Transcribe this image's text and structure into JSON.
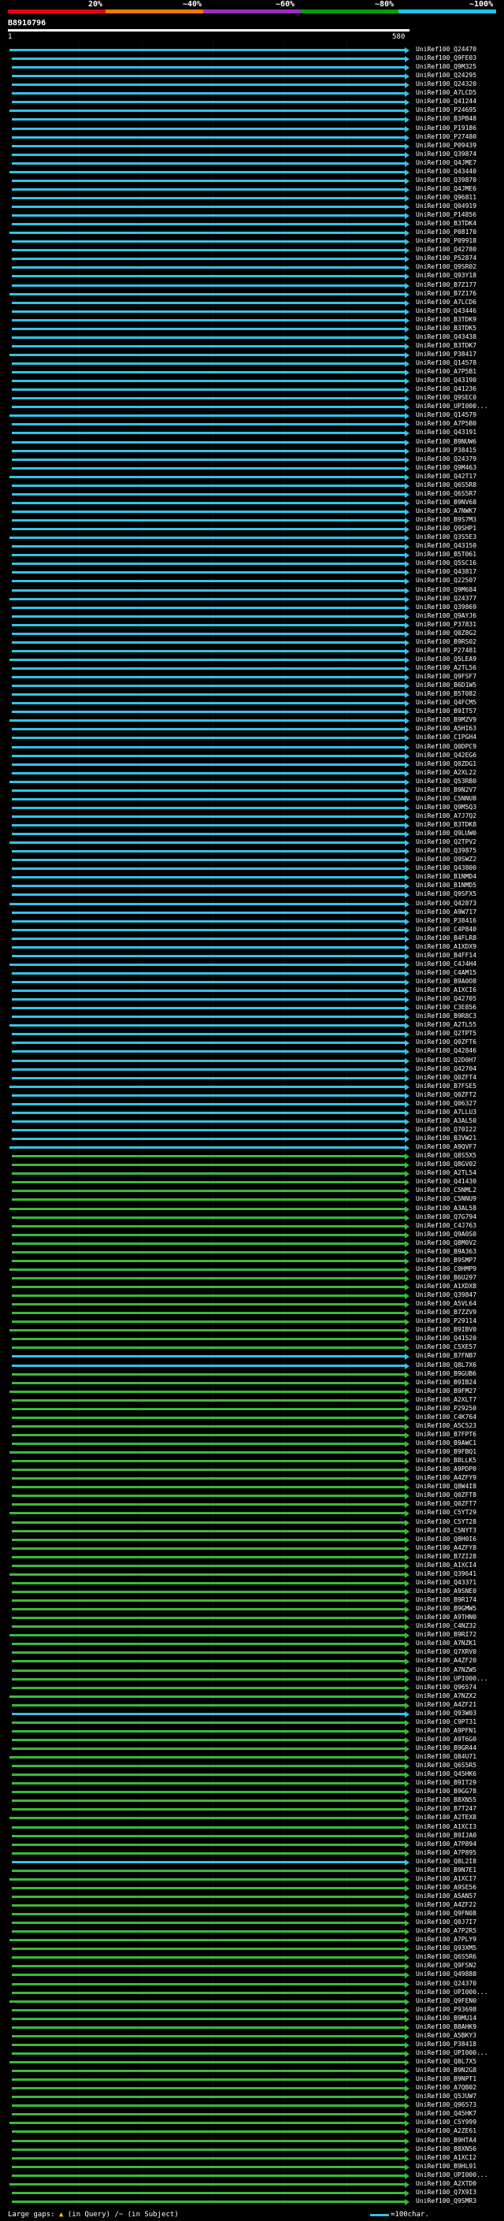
{
  "scale": {
    "labels": [
      "20%",
      "~40%",
      "~60%",
      "~80%",
      "~100%"
    ],
    "colors": [
      "#e8000b",
      "#f07a00",
      "#9b30c0",
      "#00a000",
      "#10c8ff"
    ]
  },
  "query": {
    "id": "B8910796",
    "start": "1",
    "end": "580"
  },
  "colors": {
    "green": "#3cb83c",
    "cyan": "#33c3e5",
    "dark": "#7aa07a",
    "ruler": "#ffffff"
  },
  "hits": [
    {
      "id": "UniRef100_Q24470",
      "color": "cyan"
    },
    {
      "id": "UniRef100_Q9FE03",
      "color": "cyan"
    },
    {
      "id": "UniRef100_Q9M325",
      "color": "cyan"
    },
    {
      "id": "UniRef100_Q24295",
      "color": "cyan"
    },
    {
      "id": "UniRef100_Q24320",
      "color": "cyan"
    },
    {
      "id": "UniRef100_A7LCD5",
      "color": "cyan"
    },
    {
      "id": "UniRef100_Q41244",
      "color": "cyan"
    },
    {
      "id": "UniRef100_P24695",
      "color": "cyan"
    },
    {
      "id": "UniRef100_B3PB48",
      "color": "cyan"
    },
    {
      "id": "UniRef100_P19186",
      "color": "cyan"
    },
    {
      "id": "UniRef100_P27480",
      "color": "cyan"
    },
    {
      "id": "UniRef100_P09439",
      "color": "cyan"
    },
    {
      "id": "UniRef100_Q39874",
      "color": "cyan"
    },
    {
      "id": "UniRef100_Q4JME7",
      "color": "cyan"
    },
    {
      "id": "UniRef100_Q43440",
      "color": "cyan"
    },
    {
      "id": "UniRef100_Q39870",
      "color": "cyan"
    },
    {
      "id": "UniRef100_Q4JME6",
      "color": "cyan"
    },
    {
      "id": "UniRef100_Q96811",
      "color": "cyan"
    },
    {
      "id": "UniRef100_Q04919",
      "color": "cyan"
    },
    {
      "id": "UniRef100_P14856",
      "color": "cyan"
    },
    {
      "id": "UniRef100_B3TDK4",
      "color": "cyan"
    },
    {
      "id": "UniRef100_P08170",
      "color": "cyan"
    },
    {
      "id": "UniRef100_P09918",
      "color": "cyan"
    },
    {
      "id": "UniRef100_Q42780",
      "color": "cyan"
    },
    {
      "id": "UniRef100_P52874",
      "color": "cyan"
    },
    {
      "id": "UniRef100_Q9SR02",
      "color": "cyan"
    },
    {
      "id": "UniRef100_Q93Y18",
      "color": "cyan"
    },
    {
      "id": "UniRef100_B7Z177",
      "color": "cyan"
    },
    {
      "id": "UniRef100_B7Z176",
      "color": "cyan"
    },
    {
      "id": "UniRef100_A7LCD6",
      "color": "cyan"
    },
    {
      "id": "UniRef100_Q43446",
      "color": "cyan"
    },
    {
      "id": "UniRef100_B3TDK9",
      "color": "cyan"
    },
    {
      "id": "UniRef100_B3TDK5",
      "color": "cyan"
    },
    {
      "id": "UniRef100_Q43438",
      "color": "cyan"
    },
    {
      "id": "UniRef100_B3TDK7",
      "color": "cyan"
    },
    {
      "id": "UniRef100_P38417",
      "color": "cyan"
    },
    {
      "id": "UniRef100_Q14578",
      "color": "cyan"
    },
    {
      "id": "UniRef100_A7P5B1",
      "color": "cyan"
    },
    {
      "id": "UniRef100_Q43190",
      "color": "cyan"
    },
    {
      "id": "UniRef100_Q41236",
      "color": "cyan"
    },
    {
      "id": "UniRef100_Q9SEC0",
      "color": "cyan"
    },
    {
      "id": "UniRef100_UPI000...",
      "color": "cyan"
    },
    {
      "id": "UniRef100_Q14579",
      "color": "cyan"
    },
    {
      "id": "UniRef100_A7P5B0",
      "color": "cyan"
    },
    {
      "id": "UniRef100_Q43191",
      "color": "cyan"
    },
    {
      "id": "UniRef100_B9NUW6",
      "color": "cyan"
    },
    {
      "id": "UniRef100_P38415",
      "color": "cyan"
    },
    {
      "id": "UniRef100_Q24379",
      "color": "cyan"
    },
    {
      "id": "UniRef100_Q9M463",
      "color": "cyan"
    },
    {
      "id": "UniRef100_Q42T17",
      "color": "cyan"
    },
    {
      "id": "UniRef100_Q6S5R8",
      "color": "cyan"
    },
    {
      "id": "UniRef100_Q6S5R7",
      "color": "cyan"
    },
    {
      "id": "UniRef100_B9NV68",
      "color": "cyan"
    },
    {
      "id": "UniRef100_A7NWK7",
      "color": "cyan"
    },
    {
      "id": "UniRef100_B9S7M3",
      "color": "cyan"
    },
    {
      "id": "UniRef100_Q9SHP1",
      "color": "cyan"
    },
    {
      "id": "UniRef100_Q3S5E3",
      "color": "cyan"
    },
    {
      "id": "UniRef100_Q43150",
      "color": "cyan"
    },
    {
      "id": "UniRef100_B5T061",
      "color": "cyan"
    },
    {
      "id": "UniRef100_Q5SC16",
      "color": "cyan"
    },
    {
      "id": "UniRef100_Q43817",
      "color": "cyan"
    },
    {
      "id": "UniRef100_Q22507",
      "color": "cyan"
    },
    {
      "id": "UniRef100_Q9M684",
      "color": "cyan"
    },
    {
      "id": "UniRef100_Q24377",
      "color": "cyan"
    },
    {
      "id": "UniRef100_Q39869",
      "color": "cyan"
    },
    {
      "id": "UniRef100_Q9AYJ6",
      "color": "cyan"
    },
    {
      "id": "UniRef100_P37831",
      "color": "cyan"
    },
    {
      "id": "UniRef100_Q0Z8G2",
      "color": "cyan"
    },
    {
      "id": "UniRef100_B9RS02",
      "color": "cyan"
    },
    {
      "id": "UniRef100_P27481",
      "color": "cyan"
    },
    {
      "id": "UniRef100_Q5LEA9",
      "color": "cyan"
    },
    {
      "id": "UniRef100_A2TL56",
      "color": "cyan"
    },
    {
      "id": "UniRef100_Q9FSF7",
      "color": "cyan"
    },
    {
      "id": "UniRef100_B6D1W5",
      "color": "cyan"
    },
    {
      "id": "UniRef100_B5T082",
      "color": "cyan"
    },
    {
      "id": "UniRef100_Q4FCM5",
      "color": "cyan"
    },
    {
      "id": "UniRef100_B9IT57",
      "color": "cyan"
    },
    {
      "id": "UniRef100_B9MZV9",
      "color": "cyan"
    },
    {
      "id": "UniRef100_A5HI63",
      "color": "cyan"
    },
    {
      "id": "UniRef100_C1PGH4",
      "color": "cyan"
    },
    {
      "id": "UniRef100_Q0DPC9",
      "color": "cyan"
    },
    {
      "id": "UniRef100_Q42EG6",
      "color": "cyan"
    },
    {
      "id": "UniRef100_Q0ZDG1",
      "color": "cyan"
    },
    {
      "id": "UniRef100_A2XL22",
      "color": "cyan"
    },
    {
      "id": "UniRef100_Q53RB0",
      "color": "cyan"
    },
    {
      "id": "UniRef100_B9N2V7",
      "color": "cyan"
    },
    {
      "id": "UniRef100_C5NNU8",
      "color": "cyan"
    },
    {
      "id": "UniRef100_Q9M5Q3",
      "color": "cyan"
    },
    {
      "id": "UniRef100_A7J7Q2",
      "color": "cyan"
    },
    {
      "id": "UniRef100_B3TDK8",
      "color": "cyan"
    },
    {
      "id": "UniRef100_Q9LUW0",
      "color": "cyan"
    },
    {
      "id": "UniRef100_Q2TPV2",
      "color": "cyan"
    },
    {
      "id": "UniRef100_Q39875",
      "color": "cyan"
    },
    {
      "id": "UniRef100_Q9SWZ2",
      "color": "cyan"
    },
    {
      "id": "UniRef100_Q43800",
      "color": "cyan"
    },
    {
      "id": "UniRef100_B1NMD4",
      "color": "cyan"
    },
    {
      "id": "UniRef100_B1NMD5",
      "color": "cyan"
    },
    {
      "id": "UniRef100_Q9SFX5",
      "color": "cyan"
    },
    {
      "id": "UniRef100_Q42873",
      "color": "cyan"
    },
    {
      "id": "UniRef100_A9W717",
      "color": "cyan"
    },
    {
      "id": "UniRef100_P38416",
      "color": "cyan"
    },
    {
      "id": "UniRef100_C4P840",
      "color": "cyan"
    },
    {
      "id": "UniRef100_B4FLR8",
      "color": "cyan"
    },
    {
      "id": "UniRef100_A1XDX9",
      "color": "cyan"
    },
    {
      "id": "UniRef100_B4FF14",
      "color": "cyan"
    },
    {
      "id": "UniRef100_C4J4H4",
      "color": "cyan"
    },
    {
      "id": "UniRef100_C4AM15",
      "color": "cyan"
    },
    {
      "id": "UniRef100_B9A0O8",
      "color": "cyan"
    },
    {
      "id": "UniRef100_A1XCI6",
      "color": "cyan"
    },
    {
      "id": "UniRef100_Q42705",
      "color": "cyan"
    },
    {
      "id": "UniRef100_C3E856",
      "color": "cyan"
    },
    {
      "id": "UniRef100_B9R8C3",
      "color": "cyan"
    },
    {
      "id": "UniRef100_A2TL55",
      "color": "cyan"
    },
    {
      "id": "UniRef100_Q2TPT5",
      "color": "cyan"
    },
    {
      "id": "UniRef100_Q0ZFT6",
      "color": "cyan"
    },
    {
      "id": "UniRef100_Q42846",
      "color": "cyan"
    },
    {
      "id": "UniRef100_Q2D0H7",
      "color": "cyan"
    },
    {
      "id": "UniRef100_Q42704",
      "color": "cyan"
    },
    {
      "id": "UniRef100_Q0ZFT4",
      "color": "cyan"
    },
    {
      "id": "UniRef100_B7FSE5",
      "color": "cyan"
    },
    {
      "id": "UniRef100_Q0ZFT2",
      "color": "cyan"
    },
    {
      "id": "UniRef100_Q06327",
      "color": "cyan"
    },
    {
      "id": "UniRef100_A7LLU3",
      "color": "cyan"
    },
    {
      "id": "UniRef100_A3AL50",
      "color": "cyan"
    },
    {
      "id": "UniRef100_Q70I22",
      "color": "cyan"
    },
    {
      "id": "UniRef100_B3VW21",
      "color": "cyan"
    },
    {
      "id": "UniRef100_A9QVF7",
      "color": "cyan"
    },
    {
      "id": "UniRef100_Q8S5X5",
      "color": "green"
    },
    {
      "id": "UniRef100_Q8GV02",
      "color": "green"
    },
    {
      "id": "UniRef100_A2TL54",
      "color": "green"
    },
    {
      "id": "UniRef100_Q41430",
      "color": "green"
    },
    {
      "id": "UniRef100_C5NML2",
      "color": "green"
    },
    {
      "id": "UniRef100_C5NNU9",
      "color": "green"
    },
    {
      "id": "UniRef100_A3AL58",
      "color": "green"
    },
    {
      "id": "UniRef100_Q7G794",
      "color": "green"
    },
    {
      "id": "UniRef100_C4J763",
      "color": "green"
    },
    {
      "id": "UniRef100_Q9A0S0",
      "color": "green"
    },
    {
      "id": "UniRef100_Q8M0V2",
      "color": "green"
    },
    {
      "id": "UniRef100_B9A363",
      "color": "green"
    },
    {
      "id": "UniRef100_B9SMP7",
      "color": "green"
    },
    {
      "id": "UniRef100_C0HMP9",
      "color": "green"
    },
    {
      "id": "UniRef100_B6U297",
      "color": "green"
    },
    {
      "id": "UniRef100_A1XDX8",
      "color": "green"
    },
    {
      "id": "UniRef100_Q39847",
      "color": "green"
    },
    {
      "id": "UniRef100_A5VL64",
      "color": "green"
    },
    {
      "id": "UniRef100_B7ZZV9",
      "color": "green"
    },
    {
      "id": "UniRef100_P29114",
      "color": "green"
    },
    {
      "id": "UniRef100_B9IBV0",
      "color": "green"
    },
    {
      "id": "UniRef100_Q41520",
      "color": "green"
    },
    {
      "id": "UniRef100_C5XE57",
      "color": "green"
    },
    {
      "id": "UniRef100_B7FNB7",
      "color": "cyan"
    },
    {
      "id": "UniRef100_Q8L7X6",
      "color": "cyan"
    },
    {
      "id": "UniRef100_B9GUB6",
      "color": "green"
    },
    {
      "id": "UniRef100_B9IB24",
      "color": "green"
    },
    {
      "id": "UniRef100_B9FM27",
      "color": "green"
    },
    {
      "id": "UniRef100_A2XLT7",
      "color": "green"
    },
    {
      "id": "UniRef100_P29250",
      "color": "green"
    },
    {
      "id": "UniRef100_C4K764",
      "color": "green"
    },
    {
      "id": "UniRef100_A5C523",
      "color": "green"
    },
    {
      "id": "UniRef100_B7FPT6",
      "color": "green"
    },
    {
      "id": "UniRef100_B9AWC1",
      "color": "green"
    },
    {
      "id": "UniRef100_B9FBQ1",
      "color": "green"
    },
    {
      "id": "UniRef100_B8LLK5",
      "color": "green"
    },
    {
      "id": "UniRef100_A9PDP0",
      "color": "green"
    },
    {
      "id": "UniRef100_A4ZFY9",
      "color": "green"
    },
    {
      "id": "UniRef100_Q8W4I8",
      "color": "green"
    },
    {
      "id": "UniRef100_Q0ZFT8",
      "color": "green"
    },
    {
      "id": "UniRef100_Q0ZFT7",
      "color": "green"
    },
    {
      "id": "UniRef100_C5YT29",
      "color": "green"
    },
    {
      "id": "UniRef100_C5YT28",
      "color": "green"
    },
    {
      "id": "UniRef100_C5NYT3",
      "color": "green"
    },
    {
      "id": "UniRef100_Q8H0I6",
      "color": "green"
    },
    {
      "id": "UniRef100_A4ZFY8",
      "color": "green"
    },
    {
      "id": "UniRef100_B7ZI28",
      "color": "green"
    },
    {
      "id": "UniRef100_A1XCI4",
      "color": "green"
    },
    {
      "id": "UniRef100_Q39641",
      "color": "green"
    },
    {
      "id": "UniRef100_Q43371",
      "color": "green"
    },
    {
      "id": "UniRef100_A9SNE0",
      "color": "green"
    },
    {
      "id": "UniRef100_B9R174",
      "color": "green"
    },
    {
      "id": "UniRef100_B9GMW5",
      "color": "green"
    },
    {
      "id": "UniRef100_A9THN0",
      "color": "green"
    },
    {
      "id": "UniRef100_C4NZ32",
      "color": "green"
    },
    {
      "id": "UniRef100_B9RI72",
      "color": "green"
    },
    {
      "id": "UniRef100_A7NZK1",
      "color": "green"
    },
    {
      "id": "UniRef100_Q7XRV0",
      "color": "green"
    },
    {
      "id": "UniRef100_A4ZF20",
      "color": "green"
    },
    {
      "id": "UniRef100_A7NZW5",
      "color": "green"
    },
    {
      "id": "UniRef100_UPI000...",
      "color": "green"
    },
    {
      "id": "UniRef100_Q96574",
      "color": "green"
    },
    {
      "id": "UniRef100_A7NZX2",
      "color": "green"
    },
    {
      "id": "UniRef100_A4ZF21",
      "color": "green"
    },
    {
      "id": "UniRef100_Q93W03",
      "color": "cyan"
    },
    {
      "id": "UniRef100_C9PT31",
      "color": "green"
    },
    {
      "id": "UniRef100_A9PFN1",
      "color": "green"
    },
    {
      "id": "UniRef100_A9T6G0",
      "color": "green"
    },
    {
      "id": "UniRef100_B9GR44",
      "color": "green"
    },
    {
      "id": "UniRef100_Q84U71",
      "color": "green"
    },
    {
      "id": "UniRef100_Q6S5R5",
      "color": "green"
    },
    {
      "id": "UniRef100_Q45HK6",
      "color": "green"
    },
    {
      "id": "UniRef100_B9IT29",
      "color": "green"
    },
    {
      "id": "UniRef100_B9GG78",
      "color": "green"
    },
    {
      "id": "UniRef100_B8XN55",
      "color": "green"
    },
    {
      "id": "UniRef100_B7T247",
      "color": "green"
    },
    {
      "id": "UniRef100_A2TEX8",
      "color": "green"
    },
    {
      "id": "UniRef100_A1XCI3",
      "color": "green"
    },
    {
      "id": "UniRef100_B9IJA0",
      "color": "green"
    },
    {
      "id": "UniRef100_A7P894",
      "color": "green"
    },
    {
      "id": "UniRef100_A7P895",
      "color": "green"
    },
    {
      "id": "UniRef100_Q8L2I8",
      "color": "cyan"
    },
    {
      "id": "UniRef100_B9N7E1",
      "color": "green"
    },
    {
      "id": "UniRef100_A1XCI7",
      "color": "green"
    },
    {
      "id": "UniRef100_A9SE56",
      "color": "green"
    },
    {
      "id": "UniRef100_A5AN57",
      "color": "green"
    },
    {
      "id": "UniRef100_A4ZF22",
      "color": "green"
    },
    {
      "id": "UniRef100_Q9FN08",
      "color": "green"
    },
    {
      "id": "UniRef100_Q0J7I7",
      "color": "green"
    },
    {
      "id": "UniRef100_A7P2R5",
      "color": "green"
    },
    {
      "id": "UniRef100_A7PLY9",
      "color": "green"
    },
    {
      "id": "UniRef100_Q93XM5",
      "color": "green"
    },
    {
      "id": "UniRef100_Q6S5R6",
      "color": "green"
    },
    {
      "id": "UniRef100_Q9FSN2",
      "color": "green"
    },
    {
      "id": "UniRef100_Q49888",
      "color": "green"
    },
    {
      "id": "UniRef100_Q24370",
      "color": "green"
    },
    {
      "id": "UniRef100_UPI000...",
      "color": "green"
    },
    {
      "id": "UniRef100_Q9FEN0",
      "color": "green"
    },
    {
      "id": "UniRef100_P93698",
      "color": "green"
    },
    {
      "id": "UniRef100_B9MU14",
      "color": "green"
    },
    {
      "id": "UniRef100_B8AHK9",
      "color": "green"
    },
    {
      "id": "UniRef100_A5BKY3",
      "color": "green"
    },
    {
      "id": "UniRef100_P38418",
      "color": "green"
    },
    {
      "id": "UniRef100_UPI000...",
      "color": "green"
    },
    {
      "id": "UniRef100_Q8L7X5",
      "color": "green"
    },
    {
      "id": "UniRef100_B9N2G8",
      "color": "green"
    },
    {
      "id": "UniRef100_B9NPT1",
      "color": "green"
    },
    {
      "id": "UniRef100_A7QB02",
      "color": "green"
    },
    {
      "id": "UniRef100_Q5JUW7",
      "color": "green"
    },
    {
      "id": "UniRef100_Q96573",
      "color": "green"
    },
    {
      "id": "UniRef100_Q45HK7",
      "color": "green"
    },
    {
      "id": "UniRef100_C5Y999",
      "color": "green"
    },
    {
      "id": "UniRef100_A2ZE61",
      "color": "green"
    },
    {
      "id": "UniRef100_B9HTA4",
      "color": "green"
    },
    {
      "id": "UniRef100_B8XN56",
      "color": "green"
    },
    {
      "id": "UniRef100_A1XCI2",
      "color": "green"
    },
    {
      "id": "UniRef100_B9HL91",
      "color": "green"
    },
    {
      "id": "UniRef100_UPI000...",
      "color": "green"
    },
    {
      "id": "UniRef100_A2XTD0",
      "color": "green"
    },
    {
      "id": "UniRef100_Q7X9I3",
      "color": "green"
    },
    {
      "id": "UniRef100_Q9SMR3",
      "color": "green"
    }
  ],
  "footer": {
    "large_gaps_label": "Large gaps:",
    "in_query": "(in Query)",
    "in_subject": "(in Subject)",
    "scale_note": "=100char."
  }
}
